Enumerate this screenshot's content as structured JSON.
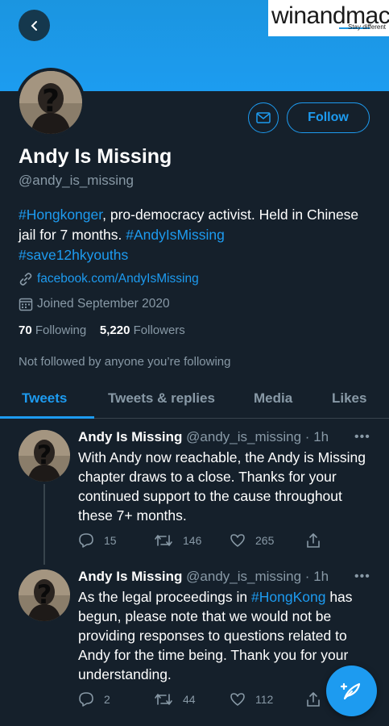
{
  "watermark": {
    "brand": "winandmac",
    "tagline": "Stay different"
  },
  "profile": {
    "name": "Andy Is Missing",
    "handle": "@andy_is_missing",
    "follow_label": "Follow",
    "bio": {
      "tag1": "#Hongkonger",
      "text1": ", pro-democracy activist. Held in Chinese jail for 7 months. ",
      "tag2": "#AndyIsMissing",
      "tag3": "#save12hkyouths"
    },
    "link": "facebook.com/AndyIsMissing",
    "joined": "Joined September 2020",
    "following_count": "70",
    "following_label": "Following",
    "followers_count": "5,220",
    "followers_label": "Followers",
    "not_followed": "Not followed by anyone you’re following"
  },
  "tabs": [
    {
      "label": "Tweets",
      "active": true
    },
    {
      "label": "Tweets & replies"
    },
    {
      "label": "Media"
    },
    {
      "label": "Likes"
    }
  ],
  "tweets": [
    {
      "name": "Andy Is Missing",
      "handle": "@andy_is_missing · 1h",
      "more": "•••",
      "text": "With Andy now reachable, the Andy is Missing chapter draws to a close. Thanks for your continued support to the cause throughout these 7+ months.",
      "replies": "15",
      "retweets": "146",
      "likes": "265"
    },
    {
      "name": "Andy Is Missing",
      "handle": "@andy_is_missing · 1h",
      "more": "•••",
      "text_pre": "As the legal proceedings in ",
      "text_tag": "#HongKong",
      "text_post": " has begun, please note that we would not be providing responses to questions related to Andy for the time being. Thank you for your understanding.",
      "replies": "2",
      "retweets": "44",
      "likes": "112"
    }
  ],
  "colors": {
    "accent": "#1d9bf0",
    "background": "#15202b",
    "secondary_text": "#8899a6",
    "banner": "#1b95e0"
  }
}
